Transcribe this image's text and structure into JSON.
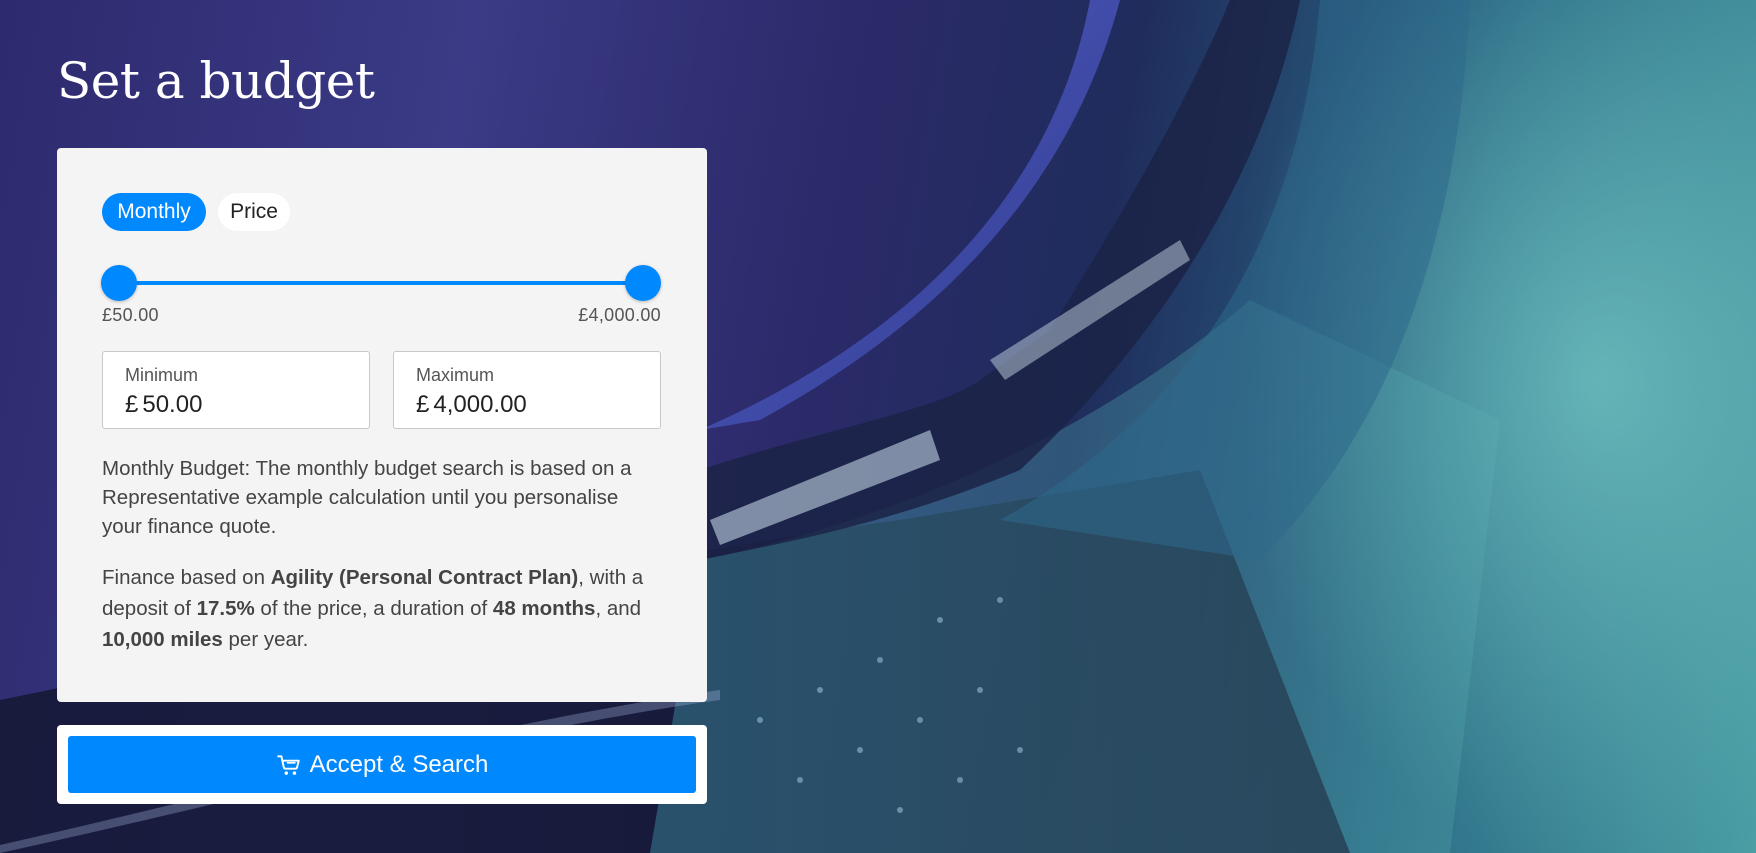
{
  "page": {
    "title": "Set a budget"
  },
  "toggle": {
    "monthly_label": "Monthly",
    "price_label": "Price",
    "active": "Monthly"
  },
  "slider": {
    "min_label": "£50.00",
    "max_label": "£4,000.00",
    "min_fraction": 0.0,
    "max_fraction": 1.0
  },
  "fields": {
    "minimum_label": "Minimum",
    "minimum_currency": "£",
    "minimum_value": "50.00",
    "maximum_label": "Maximum",
    "maximum_currency": "£",
    "maximum_value": "4,000.00"
  },
  "notes": {
    "budget": "Monthly Budget: The monthly budget search is based on a Representative example calculation until you personalise your finance quote.",
    "finance_prefix": "Finance based on ",
    "finance_plan": "Agility (Personal Contract Plan)",
    "finance_mid1": ", with a deposit of ",
    "finance_deposit": "17.5%",
    "finance_mid2": " of the price, a duration of ",
    "finance_duration": "48 months",
    "finance_mid3": ", and ",
    "finance_miles": "10,000 miles",
    "finance_suffix": " per year."
  },
  "action": {
    "search_label": "Accept & Search",
    "icon": "cart-icon"
  },
  "colors": {
    "accent": "#0088ff",
    "card_bg": "#f4f4f4"
  }
}
